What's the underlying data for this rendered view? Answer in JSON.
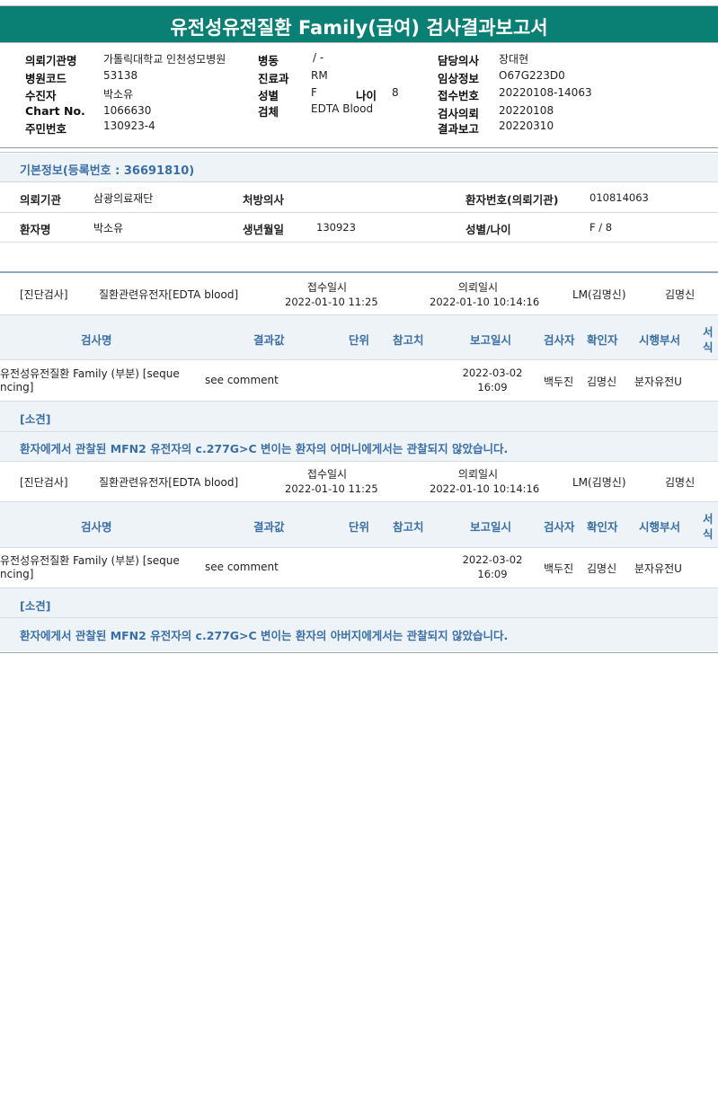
{
  "title": "유전성유전질환 Family(급여) 검사결과보고서",
  "header": {
    "rows": [
      [
        {
          "l": "의뢰기관명",
          "v": "가톨릭대학교 인천성모병원"
        },
        {
          "l": "병동",
          "v": "/ -"
        },
        {
          "l": "담당의사",
          "v": "장대현"
        }
      ],
      [
        {
          "l": "병원코드",
          "v": "53138"
        },
        {
          "l": "진료과",
          "v": "RM"
        },
        {
          "l": "임상정보",
          "v": "O67G223D0"
        }
      ],
      [
        {
          "l": "수진자",
          "v": "박소유"
        },
        {
          "l": "성별",
          "v": "F"
        },
        {
          "l": "접수번호",
          "v": "20220108-14063"
        }
      ],
      [
        {
          "l": "Chart No.",
          "v": "1066630"
        },
        {
          "l": "검체",
          "v": "EDTA Blood"
        },
        {
          "l": "검사의뢰",
          "v": "20220108"
        }
      ],
      [
        {
          "l": "주민번호",
          "v": "130923-4"
        },
        {
          "l": "",
          "v": ""
        },
        {
          "l": "결과보고",
          "v": "20220310"
        }
      ]
    ],
    "age_label": "나이",
    "age_value": "8"
  },
  "basic": {
    "title": "기본정보(등록번호 : 36691810)",
    "req_org_label": "의뢰기관",
    "req_org": "삼광의료재단",
    "doctor_label": "처방의사",
    "doctor": "",
    "patno_label": "환자번호(의뢰기관)",
    "patno": "010814063",
    "name_label": "환자명",
    "name": "박소유",
    "birth_label": "생년월일",
    "birth": "130923",
    "sexage_label": "성별/나이",
    "sexage": "F / 8"
  },
  "sections": [
    {
      "category": "[진단검사]",
      "test_group": "질환관련유전자[EDTA blood]",
      "recv_label": "접수일시",
      "recv": "2022-01-10 11:25",
      "req_label": "의뢰일시",
      "req": "2022-01-10 10:14:16",
      "lm": "LM(김명신)",
      "signer": "김명신",
      "cols": {
        "name": "검사명",
        "result": "결과값",
        "unit": "단위",
        "ref": "참고치",
        "report": "보고일시",
        "tester": "검사자",
        "confirmer": "확인자",
        "dept": "시행부서",
        "form1": "서",
        "form2": "식"
      },
      "row": {
        "name1": "유전성유전질환 Family (부분) [seque",
        "name2": "ncing]",
        "result": "see comment",
        "date1": "2022-03-02",
        "date2": "16:09",
        "tester": "백두진",
        "confirmer": "김명신",
        "dept": "분자유전U"
      },
      "opinion_label": "[소견]",
      "opinion": "환자에게서 관찰된 MFN2 유전자의 c.277G>C 변이는 환자의 어머니에게서는 관찰되지 않았습니다."
    },
    {
      "category": "[진단검사]",
      "test_group": "질환관련유전자[EDTA blood]",
      "recv_label": "접수일시",
      "recv": "2022-01-10 11:25",
      "req_label": "의뢰일시",
      "req": "2022-01-10 10:14:16",
      "lm": "LM(김명신)",
      "signer": "김명신",
      "cols": {
        "name": "검사명",
        "result": "결과값",
        "unit": "단위",
        "ref": "참고치",
        "report": "보고일시",
        "tester": "검사자",
        "confirmer": "확인자",
        "dept": "시행부서",
        "form1": "서",
        "form2": "식"
      },
      "row": {
        "name1": "유전성유전질환 Family (부분) [seque",
        "name2": "ncing]",
        "result": "see comment",
        "date1": "2022-03-02",
        "date2": "16:09",
        "tester": "백두진",
        "confirmer": "김명신",
        "dept": "분자유전U"
      },
      "opinion_label": "[소견]",
      "opinion": "환자에게서 관찰된 MFN2 유전자의 c.277G>C 변이는 환자의 아버지에게서는 관찰되지 않았습니다."
    }
  ]
}
